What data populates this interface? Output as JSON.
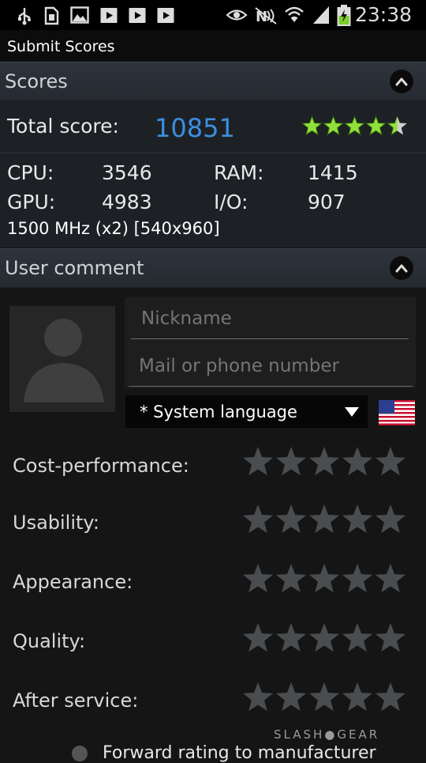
{
  "status_bar": {
    "time": "23:38"
  },
  "title_bar": {
    "title": "Submit Scores"
  },
  "scores_section": {
    "header": "Scores",
    "total_label": "Total score:",
    "total_value": "10851",
    "rating_stars": 4.5,
    "cpu_label": "CPU:",
    "cpu_value": "3546",
    "ram_label": "RAM:",
    "ram_value": "1415",
    "gpu_label": "GPU:",
    "gpu_value": "4983",
    "io_label": "I/O:",
    "io_value": "907",
    "hardware": "1500 MHz (x2) [540x960]"
  },
  "comment_section": {
    "header": "User comment",
    "nickname_placeholder": "Nickname",
    "contact_placeholder": "Mail or phone number",
    "language": "* System language",
    "ratings": [
      {
        "label": "Cost-performance:"
      },
      {
        "label": "Usability:"
      },
      {
        "label": "Appearance:"
      },
      {
        "label": "Quality:"
      },
      {
        "label": "After service:"
      }
    ],
    "forward_label": "Forward rating to manufacturer"
  },
  "watermark": "SLASH●GEAR",
  "colors": {
    "accent": "#3d8fe0",
    "star_active": "#8fe03a",
    "star_inactive": "#4a4d50"
  }
}
